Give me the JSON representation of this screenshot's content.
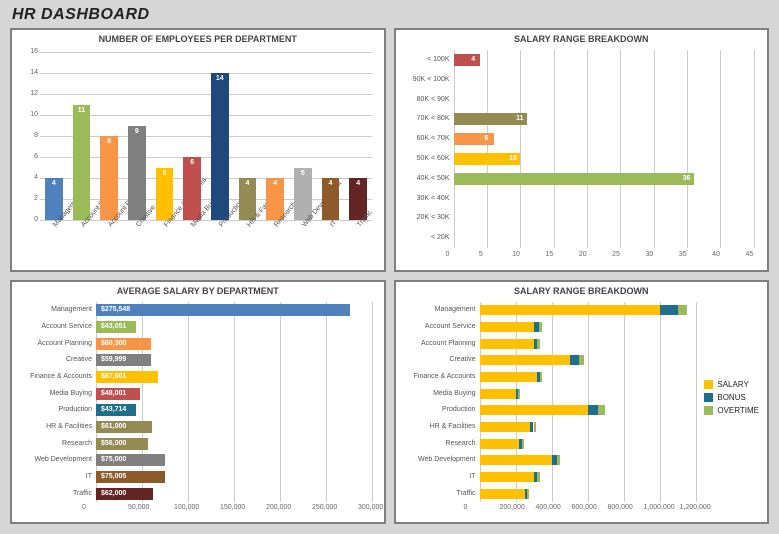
{
  "title": "HR DASHBOARD",
  "palette": {
    "blue": "#4f81bd",
    "green": "#9bbb59",
    "orange": "#f79646",
    "gray": "#808080",
    "gold": "#ffc000",
    "red": "#c0504d",
    "teal": "#1f6e8c",
    "olive": "#948a54",
    "brown": "#8c5a2b",
    "maroon": "#632523",
    "ltgray": "#b0b0b0",
    "navy": "#1f497d"
  },
  "chart_data": [
    {
      "type": "bar",
      "orientation": "vertical",
      "title": "NUMBER OF EMPLOYEES PER DEPARTMENT",
      "categories": [
        "Management",
        "Account Service",
        "Account Planning",
        "Creative",
        "Finance & Accounts",
        "Media Buying",
        "Production",
        "HR & Facilities",
        "Research",
        "Web Development",
        "IT",
        "Traffic"
      ],
      "values": [
        4,
        11,
        8,
        9,
        5,
        6,
        14,
        4,
        4,
        5,
        4,
        4
      ],
      "colors": [
        "blue",
        "green",
        "orange",
        "gray",
        "gold",
        "red",
        "navy",
        "olive",
        "orange",
        "ltgray",
        "brown",
        "maroon"
      ],
      "ylim": [
        0,
        16
      ],
      "yticks": [
        0,
        2,
        4,
        6,
        8,
        10,
        12,
        14,
        16
      ]
    },
    {
      "type": "bar",
      "orientation": "horizontal",
      "title": "SALARY RANGE BREAKDOWN",
      "categories": [
        "< 20K",
        "20K < 30K",
        "30K < 40K",
        "40K < 50K",
        "50K < 60K",
        "60K < 70K",
        "70K < 80K",
        "80K < 90K",
        "90K < 100K",
        "< 100K"
      ],
      "values": [
        0,
        0,
        0,
        36,
        10,
        6,
        11,
        0,
        0,
        4
      ],
      "colors": [
        "gray",
        "gray",
        "gray",
        "green",
        "gold",
        "orange",
        "olive",
        "gray",
        "gray",
        "red"
      ],
      "xlim": [
        0,
        45
      ],
      "xticks": [
        0,
        5,
        10,
        15,
        20,
        25,
        30,
        35,
        40,
        45
      ],
      "reverse_categories": true
    },
    {
      "type": "bar",
      "orientation": "horizontal",
      "title": "AVERAGE SALARY BY DEPARTMENT",
      "categories": [
        "Management",
        "Account Service",
        "Account Planning",
        "Creative",
        "Finance & Accounts",
        "Media Buying",
        "Production",
        "HR & Facilities",
        "Research",
        "Web Development",
        "IT",
        "Traffic"
      ],
      "values": [
        275548,
        43051,
        60300,
        59999,
        67001,
        48001,
        43714,
        61000,
        56000,
        75000,
        75005,
        62000
      ],
      "value_labels": [
        "$275,548",
        "$43,051",
        "$60,300",
        "$59,999",
        "$67,001",
        "$48,001",
        "$43,714",
        "$61,000",
        "$56,000",
        "$75,000",
        "$75,005",
        "$62,000"
      ],
      "colors": [
        "blue",
        "green",
        "orange",
        "gray",
        "gold",
        "red",
        "teal",
        "olive",
        "olive",
        "gray",
        "brown",
        "maroon"
      ],
      "xlim": [
        0,
        300000
      ],
      "xticks": [
        0,
        50000,
        100000,
        150000,
        200000,
        250000,
        300000
      ]
    },
    {
      "type": "bar-stacked",
      "orientation": "horizontal",
      "title": "SALARY RANGE BREAKDOWN",
      "categories": [
        "Management",
        "Account Service",
        "Account Planning",
        "Creative",
        "Finance & Accounts",
        "Media Buying",
        "Production",
        "HR & Facilities",
        "Research",
        "Web Development",
        "IT",
        "Traffic"
      ],
      "series": [
        {
          "name": "SALARY",
          "color": "gold",
          "values": [
            1000000,
            300000,
            300000,
            500000,
            320000,
            200000,
            600000,
            280000,
            220000,
            400000,
            300000,
            250000
          ]
        },
        {
          "name": "BONUS",
          "color": "teal",
          "values": [
            100000,
            30000,
            20000,
            50000,
            15000,
            15000,
            60000,
            20000,
            15000,
            30000,
            20000,
            15000
          ]
        },
        {
          "name": "OVERTIME",
          "color": "green",
          "values": [
            50000,
            20000,
            15000,
            30000,
            10000,
            10000,
            40000,
            15000,
            10000,
            20000,
            15000,
            10000
          ]
        }
      ],
      "xlim": [
        0,
        1200000
      ],
      "xticks": [
        0,
        200000,
        400000,
        600000,
        800000,
        1000000,
        1200000
      ],
      "legend_position": "right"
    }
  ]
}
